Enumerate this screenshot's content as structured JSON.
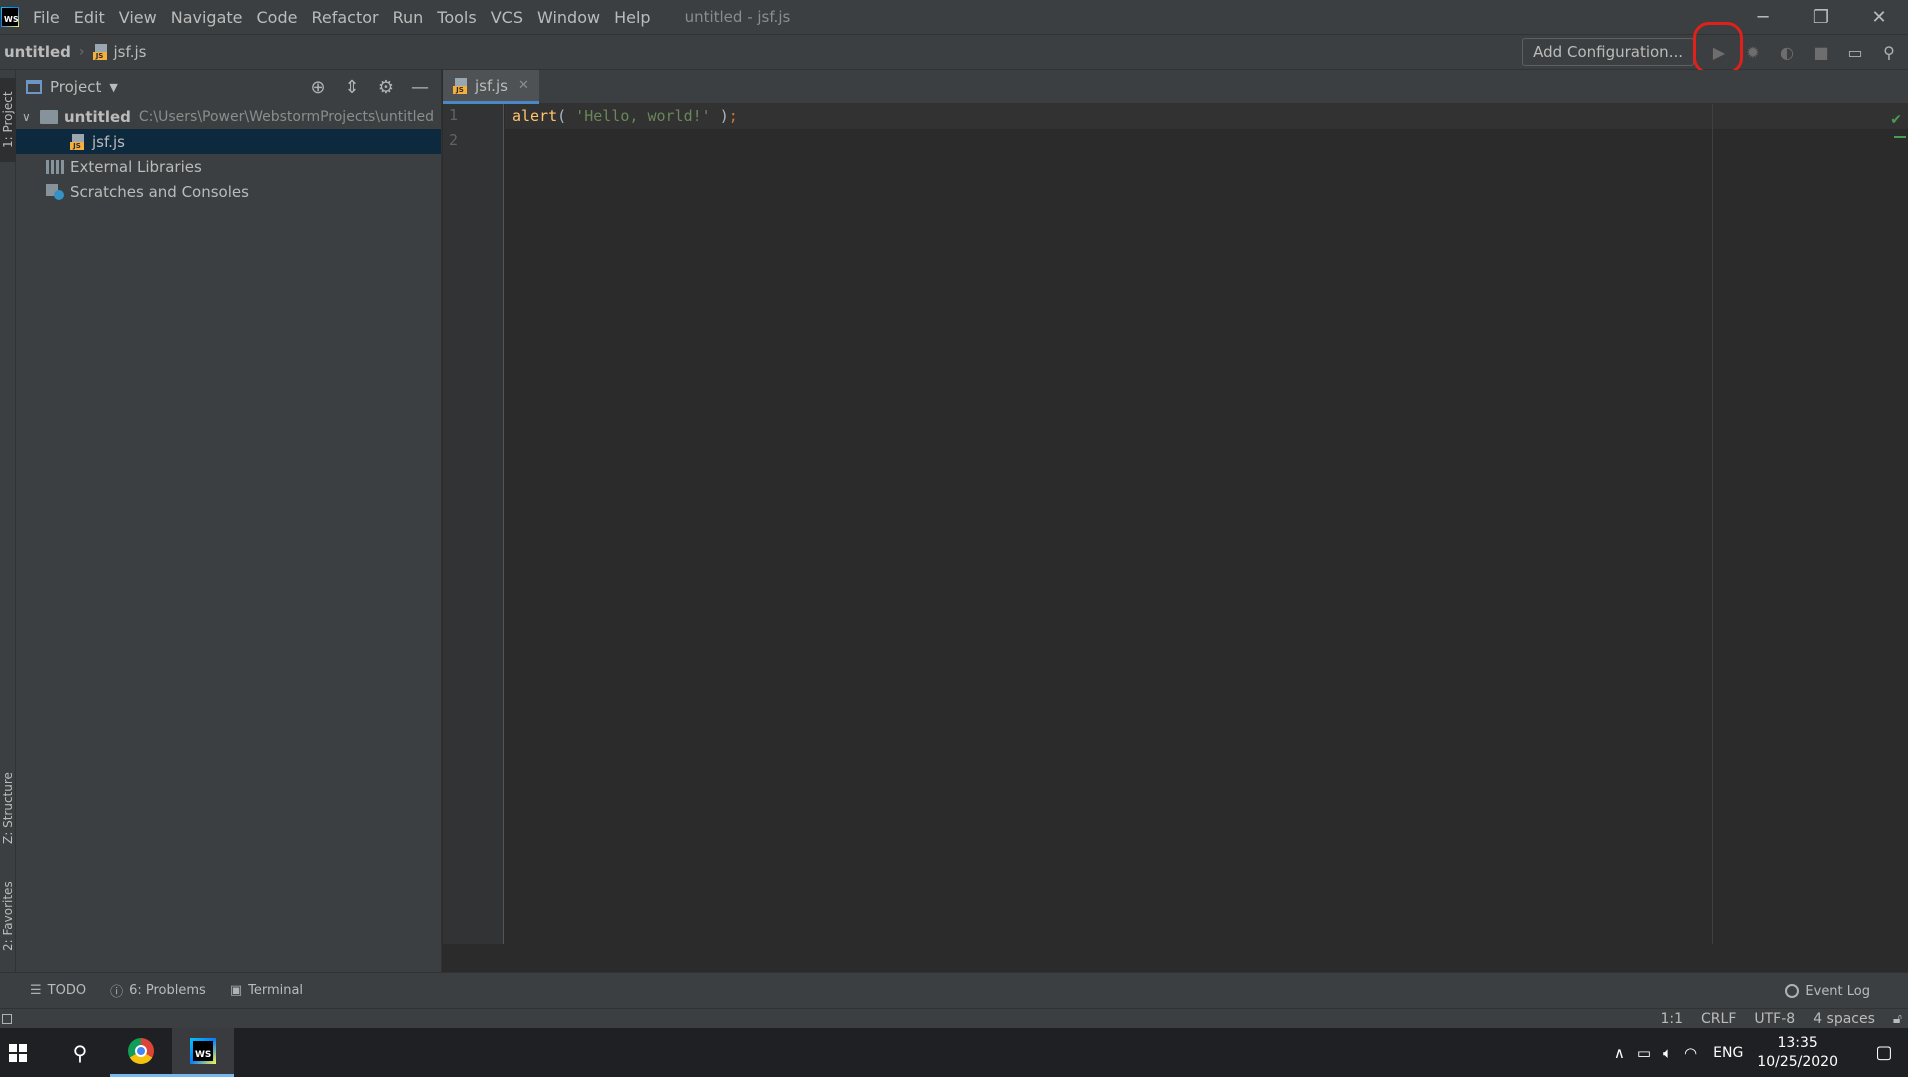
{
  "app": {
    "logo_label": "WS",
    "window_title": "untitled - jsf.js"
  },
  "menu": [
    "File",
    "Edit",
    "View",
    "Navigate",
    "Code",
    "Refactor",
    "Run",
    "Tools",
    "VCS",
    "Window",
    "Help"
  ],
  "window_controls": {
    "minimize": "─",
    "restore": "❐",
    "close": "✕"
  },
  "navbar": {
    "project": "untitled",
    "file": "jsf.js",
    "add_configuration": "Add Configuration...",
    "icons": [
      "run-icon",
      "debug-icon",
      "coverage-icon",
      "stop-icon",
      "project-structure-icon",
      "search-icon"
    ]
  },
  "left_strip": {
    "project_tab": "1: Project",
    "structure_tab": "Z: Structure",
    "favorites_tab": "2: Favorites"
  },
  "project_panel": {
    "title": "Project",
    "tree": {
      "root_name": "untitled",
      "root_path": "C:\\Users\\Power\\WebstormProjects\\untitled",
      "file": "jsf.js",
      "external_libraries": "External Libraries",
      "scratches": "Scratches and Consoles"
    }
  },
  "editor": {
    "tab_label": "jsf.js",
    "line_numbers": [
      "1",
      "2"
    ],
    "code": {
      "fn": "alert",
      "open": "( ",
      "string": "'Hello, world!'",
      "close": " )",
      "semi": ";"
    }
  },
  "bottom_tools": {
    "todo": "TODO",
    "problems": "6: Problems",
    "terminal": "Terminal",
    "event_log": "Event Log"
  },
  "status": {
    "position": "1:1",
    "line_sep": "CRLF",
    "encoding": "UTF-8",
    "indent": "4 spaces"
  },
  "taskbar": {
    "language": "ENG",
    "time": "13:35",
    "date": "10/25/2020"
  },
  "colors": {
    "accent": "#4a88c7",
    "highlight_circle": "#e0201b",
    "selection": "#0d293e"
  }
}
